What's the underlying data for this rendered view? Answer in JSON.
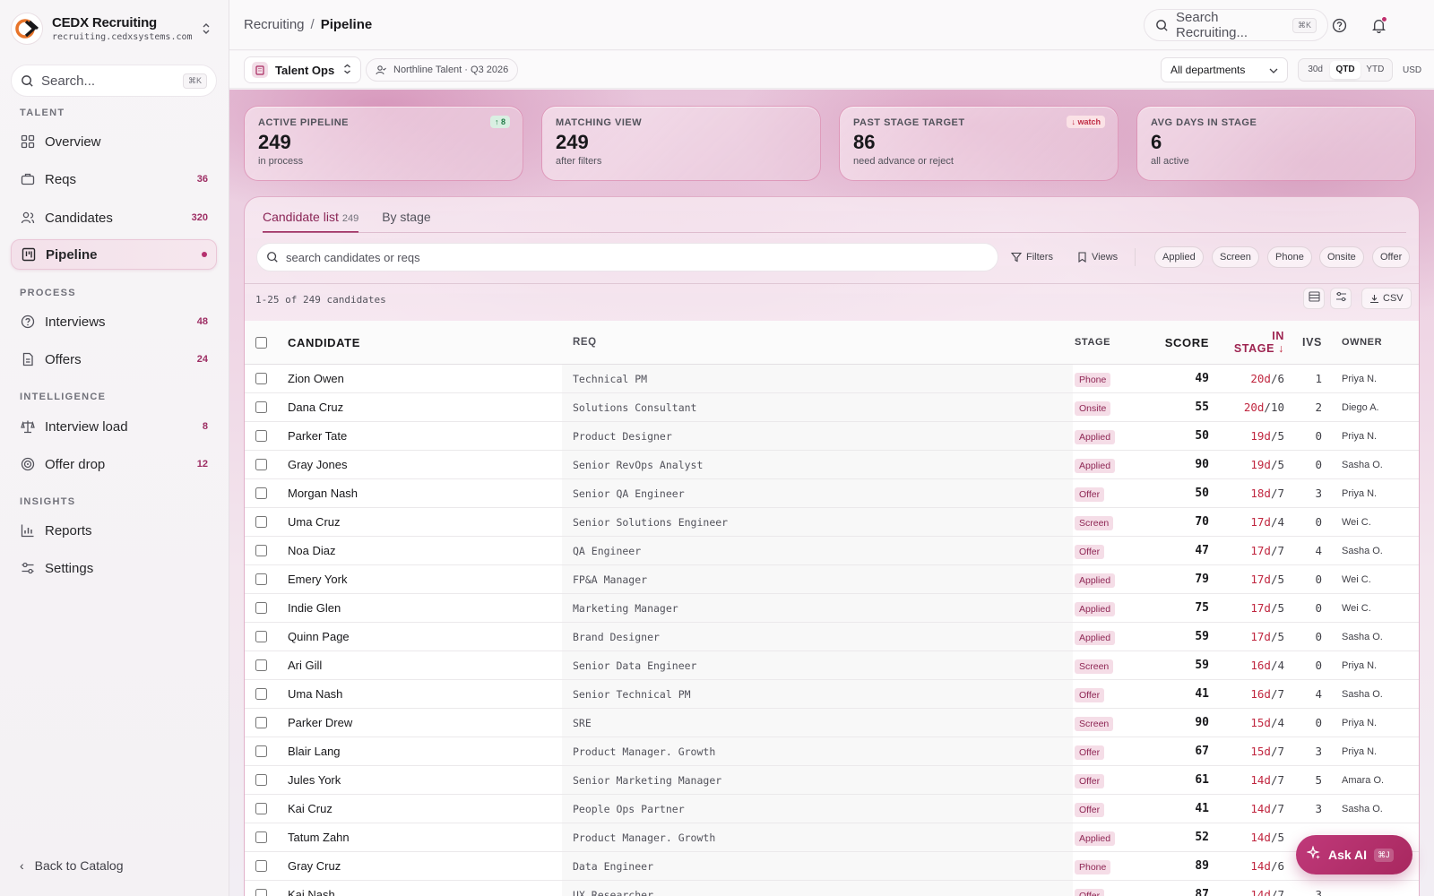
{
  "brand": {
    "name": "CEDX Recruiting",
    "url": "recruiting.cedxsystems.com"
  },
  "sidebar": {
    "search_placeholder": "Search...",
    "search_shortcut": "⌘K",
    "sections": {
      "talent": "TALENT",
      "process": "PROCESS",
      "intelligence": "INTELLIGENCE",
      "insights": "INSIGHTS"
    },
    "items": [
      {
        "label": "Overview",
        "count": "",
        "icon": "grid-icon"
      },
      {
        "label": "Reqs",
        "count": "36",
        "icon": "briefcase-icon"
      },
      {
        "label": "Candidates",
        "count": "320",
        "icon": "users-icon"
      },
      {
        "label": "Pipeline",
        "count": "",
        "icon": "kanban-icon",
        "active": true
      },
      {
        "label": "Interviews",
        "count": "48",
        "icon": "question-circle-icon"
      },
      {
        "label": "Offers",
        "count": "24",
        "icon": "document-icon"
      },
      {
        "label": "Interview load",
        "count": "8",
        "icon": "scale-icon"
      },
      {
        "label": "Offer drop",
        "count": "12",
        "icon": "target-icon"
      },
      {
        "label": "Reports",
        "count": "",
        "icon": "bar-chart-icon"
      },
      {
        "label": "Settings",
        "count": "",
        "icon": "sliders-icon"
      }
    ],
    "back_label": "Back to Catalog"
  },
  "topbar": {
    "breadcrumb_parent": "Recruiting",
    "breadcrumb_sep": "/",
    "breadcrumb_current": "Pipeline",
    "search_placeholder": "Search Recruiting...",
    "search_shortcut": "⌘K"
  },
  "subbar": {
    "workspace": "Talent Ops",
    "org": "Northline Talent · Q3 2026",
    "department": "All departments",
    "ranges": [
      "30d",
      "QTD",
      "YTD"
    ],
    "active_range": "QTD",
    "currency": "USD"
  },
  "stats": [
    {
      "label": "ACTIVE PIPELINE",
      "value": "249",
      "sub": "in process",
      "badge": "↑ 8",
      "badge_type": "up"
    },
    {
      "label": "MATCHING VIEW",
      "value": "249",
      "sub": "after filters",
      "badge": "",
      "badge_type": ""
    },
    {
      "label": "PAST STAGE TARGET",
      "value": "86",
      "sub": "need advance or reject",
      "badge": "↓ watch",
      "badge_type": "watch"
    },
    {
      "label": "AVG DAYS IN STAGE",
      "value": "6",
      "sub": "all active",
      "badge": "",
      "badge_type": ""
    }
  ],
  "list": {
    "tabs": [
      {
        "label": "Candidate list",
        "count": "249",
        "active": true
      },
      {
        "label": "By stage",
        "count": "",
        "active": false
      }
    ],
    "search_placeholder": "search candidates or reqs",
    "filters_label": "Filters",
    "views_label": "Views",
    "stage_chips": [
      "Applied",
      "Screen",
      "Phone",
      "Onsite",
      "Offer"
    ],
    "range_text": "1-25 of 249 candidates",
    "csv_label": "CSV"
  },
  "table": {
    "columns": {
      "candidate": "CANDIDATE",
      "req": "REQ",
      "stage": "STAGE",
      "score": "SCORE",
      "in_stage_1": "IN",
      "in_stage_2": "STAGE",
      "sort_arrow": "↓",
      "ivs": "IVS",
      "owner": "OWNER"
    },
    "rows": [
      {
        "name": "Zion Owen",
        "req": "Technical PM",
        "stage": "Phone",
        "score": "49",
        "days": "20d",
        "target": "/6",
        "ivs": "1",
        "owner": "Priya N."
      },
      {
        "name": "Dana Cruz",
        "req": "Solutions Consultant",
        "stage": "Onsite",
        "score": "55",
        "days": "20d",
        "target": "/10",
        "ivs": "2",
        "owner": "Diego A."
      },
      {
        "name": "Parker Tate",
        "req": "Product Designer",
        "stage": "Applied",
        "score": "50",
        "days": "19d",
        "target": "/5",
        "ivs": "0",
        "owner": "Priya N."
      },
      {
        "name": "Gray Jones",
        "req": "Senior RevOps Analyst",
        "stage": "Applied",
        "score": "90",
        "days": "19d",
        "target": "/5",
        "ivs": "0",
        "owner": "Sasha O."
      },
      {
        "name": "Morgan Nash",
        "req": "Senior QA Engineer",
        "stage": "Offer",
        "score": "50",
        "days": "18d",
        "target": "/7",
        "ivs": "3",
        "owner": "Priya N."
      },
      {
        "name": "Uma Cruz",
        "req": "Senior Solutions Engineer",
        "stage": "Screen",
        "score": "70",
        "days": "17d",
        "target": "/4",
        "ivs": "0",
        "owner": "Wei C."
      },
      {
        "name": "Noa Diaz",
        "req": "QA Engineer",
        "stage": "Offer",
        "score": "47",
        "days": "17d",
        "target": "/7",
        "ivs": "4",
        "owner": "Sasha O."
      },
      {
        "name": "Emery York",
        "req": "FP&A Manager",
        "stage": "Applied",
        "score": "79",
        "days": "17d",
        "target": "/5",
        "ivs": "0",
        "owner": "Wei C."
      },
      {
        "name": "Indie Glen",
        "req": "Marketing Manager",
        "stage": "Applied",
        "score": "75",
        "days": "17d",
        "target": "/5",
        "ivs": "0",
        "owner": "Wei C."
      },
      {
        "name": "Quinn Page",
        "req": "Brand Designer",
        "stage": "Applied",
        "score": "59",
        "days": "17d",
        "target": "/5",
        "ivs": "0",
        "owner": "Sasha O."
      },
      {
        "name": "Ari Gill",
        "req": "Senior Data Engineer",
        "stage": "Screen",
        "score": "59",
        "days": "16d",
        "target": "/4",
        "ivs": "0",
        "owner": "Priya N."
      },
      {
        "name": "Uma Nash",
        "req": "Senior Technical PM",
        "stage": "Offer",
        "score": "41",
        "days": "16d",
        "target": "/7",
        "ivs": "4",
        "owner": "Sasha O."
      },
      {
        "name": "Parker Drew",
        "req": "SRE",
        "stage": "Screen",
        "score": "90",
        "days": "15d",
        "target": "/4",
        "ivs": "0",
        "owner": "Priya N."
      },
      {
        "name": "Blair Lang",
        "req": "Product Manager. Growth",
        "stage": "Offer",
        "score": "67",
        "days": "15d",
        "target": "/7",
        "ivs": "3",
        "owner": "Priya N."
      },
      {
        "name": "Jules York",
        "req": "Senior Marketing Manager",
        "stage": "Offer",
        "score": "61",
        "days": "14d",
        "target": "/7",
        "ivs": "5",
        "owner": "Amara O."
      },
      {
        "name": "Kai Cruz",
        "req": "People Ops Partner",
        "stage": "Offer",
        "score": "41",
        "days": "14d",
        "target": "/7",
        "ivs": "3",
        "owner": "Sasha O."
      },
      {
        "name": "Tatum Zahn",
        "req": "Product Manager. Growth",
        "stage": "Applied",
        "score": "52",
        "days": "14d",
        "target": "/5",
        "ivs": "",
        "owner": ""
      },
      {
        "name": "Gray Cruz",
        "req": "Data Engineer",
        "stage": "Phone",
        "score": "89",
        "days": "14d",
        "target": "/6",
        "ivs": "",
        "owner": ""
      },
      {
        "name": "Kai Nash",
        "req": "UX Researcher",
        "stage": "Offer",
        "score": "87",
        "days": "14d",
        "target": "/7",
        "ivs": "3",
        "owner": ""
      }
    ]
  },
  "ask_ai": {
    "label": "Ask AI",
    "shortcut": "⌘J"
  },
  "colors": {
    "accent": "#a8285f",
    "overdue": "#c0263f",
    "badge_bg": "#f5dde7"
  }
}
